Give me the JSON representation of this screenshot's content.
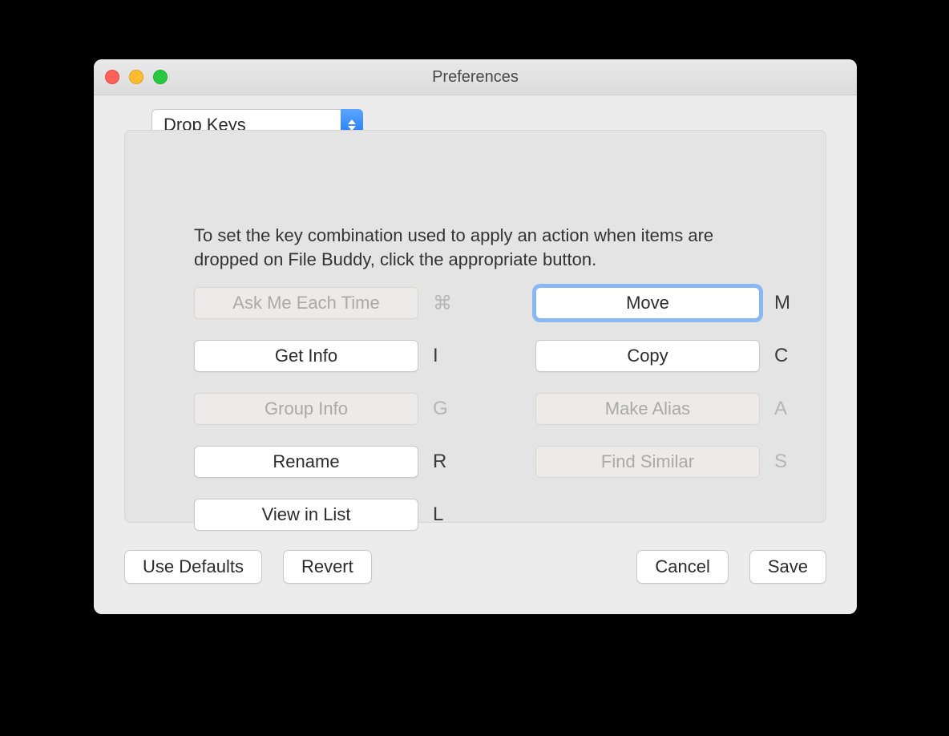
{
  "window": {
    "title": "Preferences"
  },
  "popup": {
    "selected": "Drop Keys"
  },
  "description": "To set the key combination used to apply an action when items are dropped on File Buddy, click the appropriate button.",
  "keys": {
    "left": [
      {
        "label": "Ask Me Each Time",
        "shortcut": "⌘",
        "enabled": false,
        "focused": false
      },
      {
        "label": "Get Info",
        "shortcut": "I",
        "enabled": true,
        "focused": false
      },
      {
        "label": "Group Info",
        "shortcut": "G",
        "enabled": false,
        "focused": false
      },
      {
        "label": "Rename",
        "shortcut": "R",
        "enabled": true,
        "focused": false
      },
      {
        "label": "View in List",
        "shortcut": "L",
        "enabled": true,
        "focused": false
      }
    ],
    "right": [
      {
        "label": "Move",
        "shortcut": "M",
        "enabled": true,
        "focused": true
      },
      {
        "label": "Copy",
        "shortcut": "C",
        "enabled": true,
        "focused": false
      },
      {
        "label": "Make Alias",
        "shortcut": "A",
        "enabled": false,
        "focused": false
      },
      {
        "label": "Find Similar",
        "shortcut": "S",
        "enabled": false,
        "focused": false
      }
    ]
  },
  "footer": {
    "use_defaults": "Use Defaults",
    "revert": "Revert",
    "cancel": "Cancel",
    "save": "Save"
  }
}
